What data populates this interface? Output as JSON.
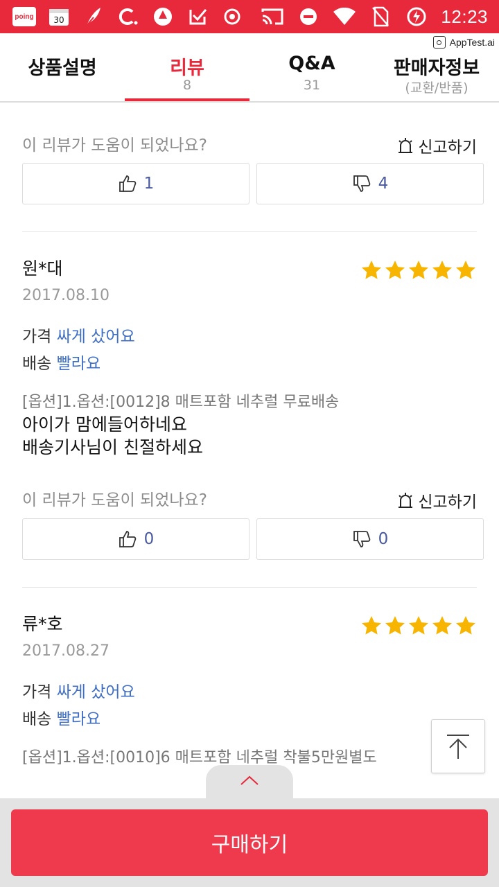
{
  "status_bar": {
    "time": "12:23",
    "left_icons": [
      "poing-app-icon",
      "calendar-icon",
      "feather-app-icon",
      "c-app-icon",
      "recycle-app-icon",
      "checkbox-app-icon",
      "record-icon"
    ],
    "poing_label": "poing",
    "calendar_day": "30",
    "right_icons": [
      "cast-icon",
      "do-not-disturb-icon",
      "wifi-icon",
      "no-sim-icon",
      "battery-charging-icon"
    ],
    "color": "#e8293c"
  },
  "watermark": {
    "label": "AppTest.ai"
  },
  "tabs": [
    {
      "title": "상품설명",
      "sub": ""
    },
    {
      "title": "리뷰",
      "sub": "8",
      "active": true
    },
    {
      "title": "Q&A",
      "sub": "31"
    },
    {
      "title": "판매자정보",
      "sub": "(교환/반품)"
    }
  ],
  "helpful_question": "이 리뷰가 도움이 되었나요?",
  "report_label": "신고하기",
  "top_votes": {
    "up": "1",
    "down": "4"
  },
  "reviews": [
    {
      "name": "원*대",
      "date": "2017.08.10",
      "rating": 5,
      "price_key": "가격",
      "price_val": "싸게 샀어요",
      "ship_key": "배송",
      "ship_val": "빨라요",
      "option": "[옵션]1.옵션:[0012]8 매트포함 네추럴 무료배송",
      "body_line1": "아이가 맘에들어하네요",
      "body_line2": "배송기사님이 친절하세요",
      "votes_up": "0",
      "votes_down": "0"
    },
    {
      "name": "류*호",
      "date": "2017.08.27",
      "rating": 5,
      "price_key": "가격",
      "price_val": "싸게 샀어요",
      "ship_key": "배송",
      "ship_val": "빨라요",
      "option": "[옵션]1.옵션:[0010]6 매트포함 네추럴 착불5만원별도"
    }
  ],
  "buy_button": "구매하기",
  "colors": {
    "accent": "#e8293c",
    "star": "#f7b500",
    "value_blue": "#3f6fc4",
    "count_blue": "#4a5aa0"
  }
}
